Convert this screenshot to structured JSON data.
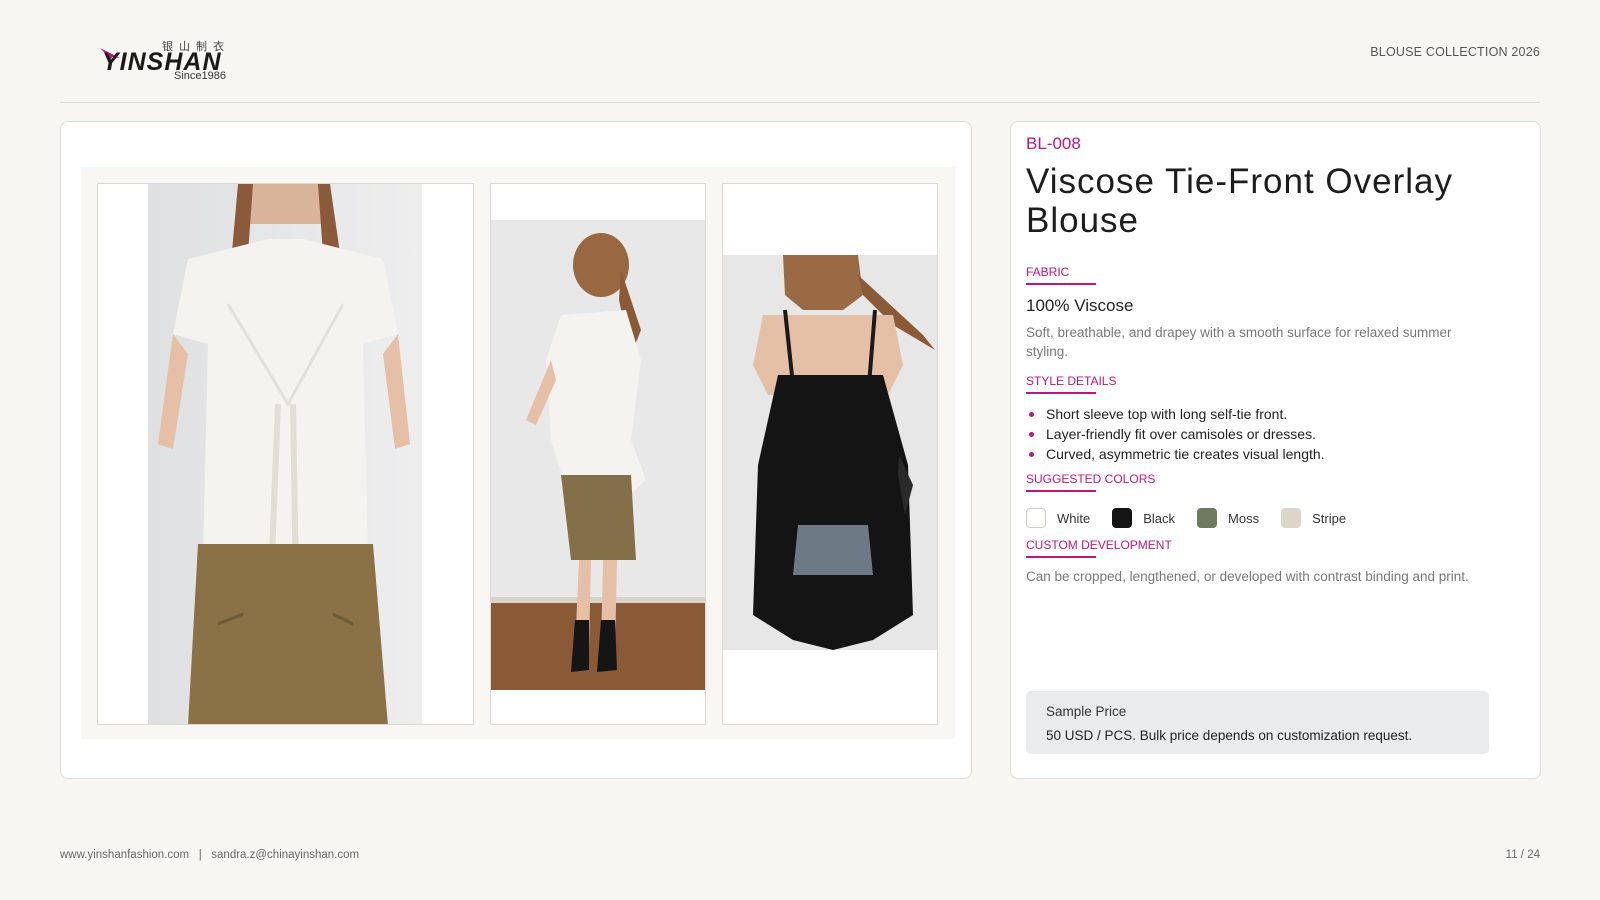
{
  "header": {
    "logo": {
      "chinese": "银山制衣",
      "brand": "YINSHAN",
      "since": "Since1986"
    },
    "collection": "BLOUSE COLLECTION 2026"
  },
  "gallery": {
    "photos": [
      {
        "name": "front-view-photo",
        "garment_color": "#f4f3ef"
      },
      {
        "name": "side-view-photo",
        "garment_color": "#f4f3ef"
      },
      {
        "name": "back-view-photo",
        "garment_color": "#141414"
      }
    ]
  },
  "product": {
    "code": "BL-008",
    "title": "Viscose Tie-Front Overlay Blouse",
    "fabric": {
      "label": "FABRIC",
      "value": "100% Viscose",
      "description": "Soft, breathable, and drapey with a smooth surface for relaxed summer styling."
    },
    "style": {
      "label": "STYLE DETAILS",
      "items": [
        "Short sleeve top with long self-tie front.",
        "Layer-friendly fit over camisoles or dresses.",
        "Curved, asymmetric tie creates visual length."
      ]
    },
    "colors": {
      "label": "SUGGESTED COLORS",
      "items": [
        {
          "name": "White",
          "hex": "#ffffff",
          "border": "#cfcac2"
        },
        {
          "name": "Black",
          "hex": "#141414",
          "border": "#141414"
        },
        {
          "name": "Moss",
          "hex": "#6e7a5c",
          "border": "#6e7a5c"
        },
        {
          "name": "Stripe",
          "hex": "#dcd6c8",
          "border": "#dcd6c8"
        }
      ]
    },
    "custom": {
      "label": "CUSTOM DEVELOPMENT",
      "description": "Can be cropped, lengthened, or developed with contrast binding and print."
    },
    "price": {
      "title": "Sample Price",
      "text": "50 USD / PCS. Bulk price depends on customization request."
    }
  },
  "footer": {
    "contact": "www.yinshanfashion.com   |   sandra.z@chinayinshan.com",
    "page": "11 / 24"
  },
  "colors": {
    "accent": "#c0157d",
    "background": "#f7f6f3"
  }
}
